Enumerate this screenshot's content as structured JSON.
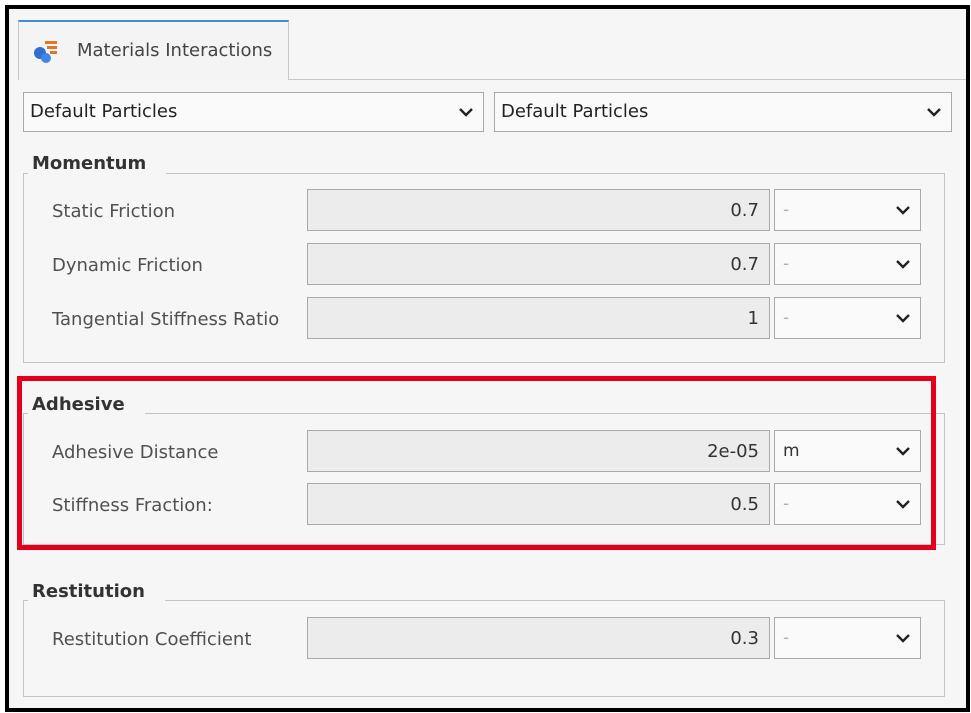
{
  "tab": {
    "label": "Materials Interactions",
    "icon": "materials-interactions-icon"
  },
  "materials": {
    "left": {
      "selected": "Default Particles"
    },
    "right": {
      "selected": "Default Particles"
    }
  },
  "momentum": {
    "title": "Momentum",
    "rows": [
      {
        "label": "Static Friction",
        "value": "0.7",
        "unit": "-"
      },
      {
        "label": "Dynamic Friction",
        "value": "0.7",
        "unit": "-"
      },
      {
        "label": "Tangential Stiffness Ratio",
        "value": "1",
        "unit": "-"
      }
    ]
  },
  "adhesive": {
    "title": "Adhesive",
    "rows": [
      {
        "label": "Adhesive Distance",
        "value": "2e-05",
        "unit": "m"
      },
      {
        "label": "Stiffness Fraction:",
        "value": "0.5",
        "unit": "-"
      }
    ]
  },
  "restitution": {
    "title": "Restitution",
    "rows": [
      {
        "label": "Restitution Coefficient",
        "value": "0.3",
        "unit": "-"
      }
    ]
  },
  "colors": {
    "highlight": "#e2001a",
    "tab_accent": "#3c8fd6"
  }
}
